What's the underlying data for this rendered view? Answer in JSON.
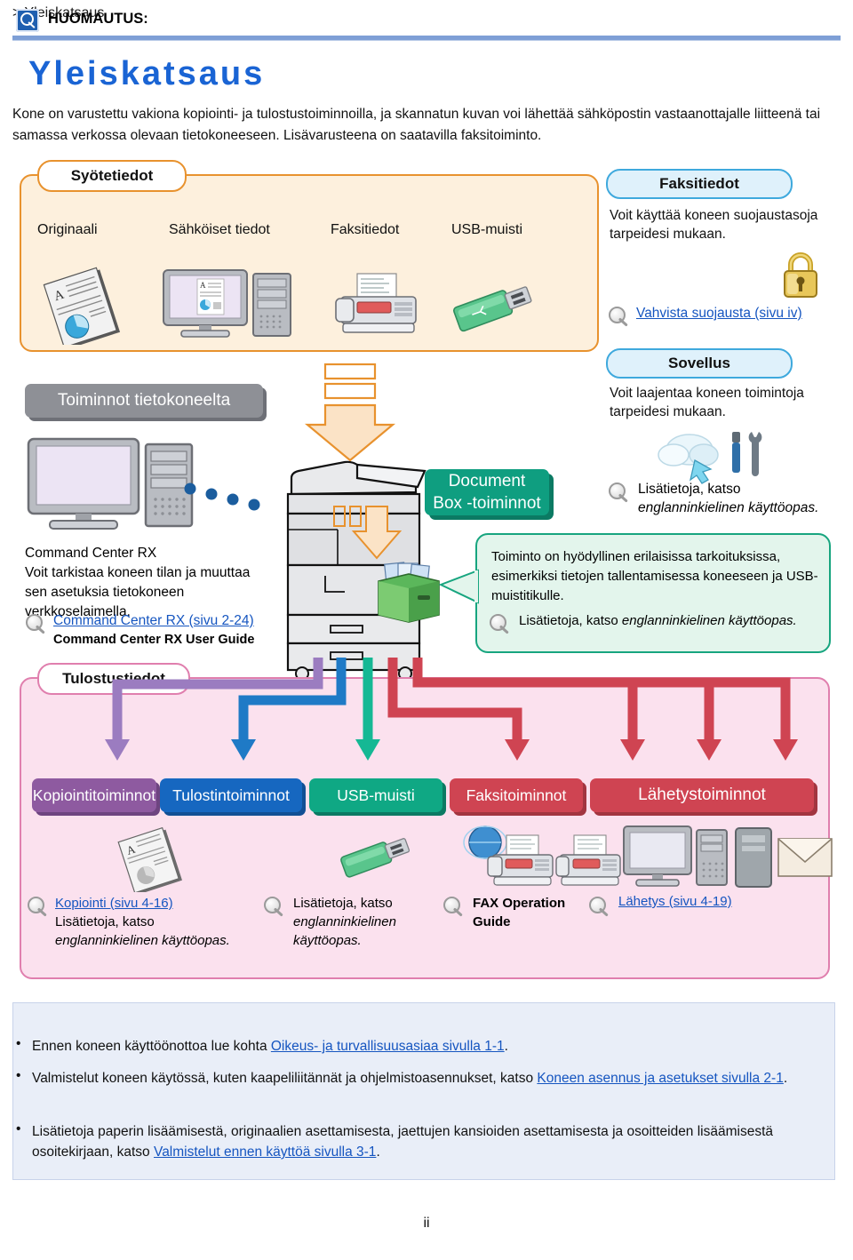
{
  "header": {
    "breadcrumb": "> Yleiskatsaus",
    "title": "Yleiskatsaus",
    "intro": "Kone on varustettu vakiona kopiointi- ja tulostustoiminnoilla, ja skannatun kuvan voi lähettää sähköpostin vastaanottajalle liitteenä tai samassa verkossa olevaan tietokoneeseen. Lisävarusteena on saatavilla faksitoiminto."
  },
  "input_panel": {
    "pill_label": "Syötetiedot",
    "items": [
      {
        "label": "Originaali",
        "icon": "document-icon"
      },
      {
        "label": "Sähköiset tiedot",
        "icon": "computer-icon"
      },
      {
        "label": "Faksitiedot",
        "icon": "fax-icon"
      },
      {
        "label": "USB-muisti",
        "icon": "usb-drive-icon"
      }
    ]
  },
  "fax_panel": {
    "pill_label": "Faksitiedot",
    "text": "Voit käyttää koneen suojaustasoja tarpeidesi mukaan.",
    "icon": "padlock-icon",
    "link": "Vahvista suojausta (sivu iv)"
  },
  "app_panel": {
    "pill_label": "Sovellus",
    "text": "Voit laajentaa koneen toimintoja tarpeidesi mukaan.",
    "icon": "cloud-tools-icon",
    "ref_prefix": "Lisätietoja, katso ",
    "ref_italic": "englanninkielinen käyttöopas."
  },
  "pc_section": {
    "slab_label": "Toiminnot tietokoneelta",
    "icon": "desktop-computer-icon",
    "heading": "Command Center RX",
    "body": "Voit tarkistaa koneen tilan ja muuttaa sen asetuksia tietokoneen verkkoselaimella.",
    "link": "Command Center RX (sivu 2-24)",
    "guide": "Command Center RX User Guide"
  },
  "docbox": {
    "slab_line1": "Document",
    "slab_line2": "Box -toiminnot",
    "icon": "document-box-icon",
    "callout_text": "Toiminto on hyödyllinen erilaisissa tarkoituksissa, esimerkiksi tietojen tallentamisessa koneeseen ja USB-muistitikulle.",
    "callout_ref_prefix": "Lisätietoja, katso ",
    "callout_ref_italic": "englanninkielinen käyttöopas."
  },
  "printer": {
    "icon": "mfp-printer-icon"
  },
  "output_panel": {
    "pill_label": "Tulostustiedot",
    "tabs": [
      {
        "label": "Kopiointitoiminnot",
        "color": "#8e5aa0",
        "arrow_color": "#9b7cc0"
      },
      {
        "label": "Tulostintoiminnot",
        "color": "#1667c0",
        "arrow_color": "#1f7ac6"
      },
      {
        "label": "USB-muisti",
        "color": "#0fa884",
        "arrow_color": "#15b894"
      },
      {
        "label": "Faksitoiminnot",
        "color": "#cf4452",
        "arrow_color": "#cf4452"
      },
      {
        "label": "Lähetystoiminnot",
        "color": "#cf4452",
        "arrow_color": "#cf4452"
      }
    ],
    "refs": [
      {
        "link": "Kopiointi (sivu 4-16)",
        "plain": "Lisätietoja, katso ",
        "italic": "englanninkielinen käyttöopas."
      },
      {
        "link": "",
        "plain": "Lisätietoja, katso ",
        "italic": "englanninkielinen käyttöopas."
      },
      {
        "link": "",
        "plain": "",
        "bold": "FAX Operation Guide"
      },
      {
        "link": "Lähetys (sivu 4-19)",
        "plain": "",
        "italic": ""
      }
    ]
  },
  "note": {
    "icon": "note-magnifier-icon",
    "title": "HUOMAUTUS:",
    "items": [
      {
        "pre": "Ennen koneen käyttöönottoa lue kohta ",
        "link": "Oikeus- ja turvallisuusasiaa sivulla 1-1",
        "post": "."
      },
      {
        "pre": "Valmistelut koneen käytössä, kuten kaapeliliitännät ja ohjelmistoasennukset, katso ",
        "link": "Koneen asennus ja asetukset sivulla 2-1",
        "post": "."
      },
      {
        "pre": "Lisätietoja paperin lisäämisestä, originaalien asettamisesta, jaettujen kansioiden asettamisesta ja osoitteiden lisäämisestä osoitekirjaan, katso ",
        "link": "Valmistelut ennen käyttöä sivulla 3-1",
        "post": "."
      }
    ]
  },
  "footer": {
    "page_number": "ii"
  },
  "colors": {
    "accent_blue": "#1a64d4",
    "orange": "#e8922e",
    "pink": "#e07fae",
    "green": "#17a57f",
    "light_blue": "#3fa9dd"
  }
}
